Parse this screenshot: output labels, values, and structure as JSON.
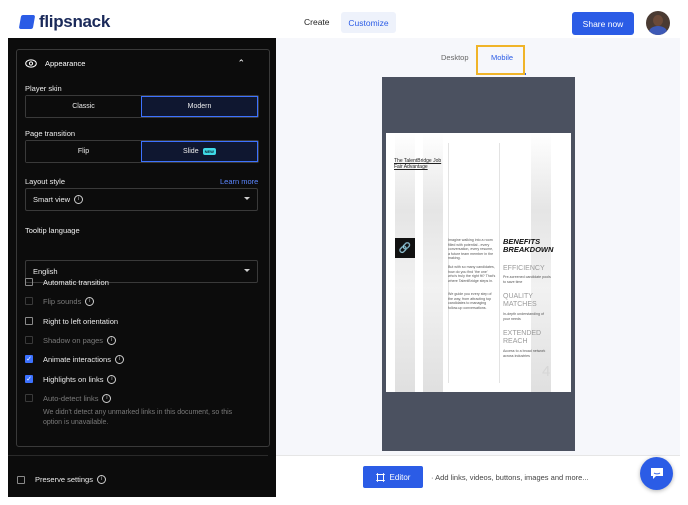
{
  "app": {
    "logo_text": "flipsnack"
  },
  "nav": {
    "create": "Create",
    "customize": "Customize",
    "share": "Share now"
  },
  "appearance": {
    "title": "Appearance",
    "player_skin": {
      "label": "Player skin",
      "options": [
        "Classic",
        "Modern"
      ],
      "selected": "Modern"
    },
    "page_transition": {
      "label": "Page transition",
      "options": [
        "Flip",
        "Slide"
      ],
      "selected": "Slide",
      "badge": "NEW"
    },
    "layout_style": {
      "label": "Layout style",
      "learn_more": "Learn more",
      "value": "Smart view"
    },
    "tooltip_language": {
      "label": "Tooltip language",
      "value": "English"
    },
    "checkboxes": [
      {
        "label": "Automatic transition",
        "checked": false,
        "enabled": true
      },
      {
        "label": "Flip sounds",
        "checked": false,
        "enabled": false
      },
      {
        "label": "Right to left orientation",
        "checked": false,
        "enabled": true
      },
      {
        "label": "Shadow on pages",
        "checked": false,
        "enabled": false
      },
      {
        "label": "Animate interactions",
        "checked": true,
        "enabled": true
      },
      {
        "label": "Highlights on links",
        "checked": true,
        "enabled": true
      },
      {
        "label": "Auto-detect links",
        "checked": false,
        "enabled": false
      }
    ],
    "auto_detect_note": "We didn't detect any unmarked links in this document, so this option is unavailable."
  },
  "preserve_settings": "Preserve settings",
  "preview": {
    "tabs": [
      "Desktop",
      "Mobile"
    ],
    "active_tab": "Mobile",
    "page": {
      "title": "The TalentBridge Job Fair Advantage",
      "col2_text_1": "Imagine walking into a room filled with potential - every conversation, every resume, a future team member in the making.",
      "col2_text_2": "But with so many candidates, how do you find 'the one' who's truly the right fit? That's where TalentBridge steps in.",
      "col2_text_3": "We guide you every step of the way, from attracting top candidates to managing follow-up conversations.",
      "benefits_title": "BENEFITS BREAKDOWN",
      "benefits": [
        {
          "heading": "EFFICIENCY",
          "text": "Pre-screened candidate pools to save time"
        },
        {
          "heading": "QUALITY MATCHES",
          "text": "In-depth understanding of your needs"
        },
        {
          "heading": "EXTENDED REACH",
          "text": "Access to a broad network across industries"
        }
      ],
      "page_number": "4"
    }
  },
  "editor": {
    "button": "Editor",
    "hint": "· Add links, videos, buttons, images and more..."
  }
}
